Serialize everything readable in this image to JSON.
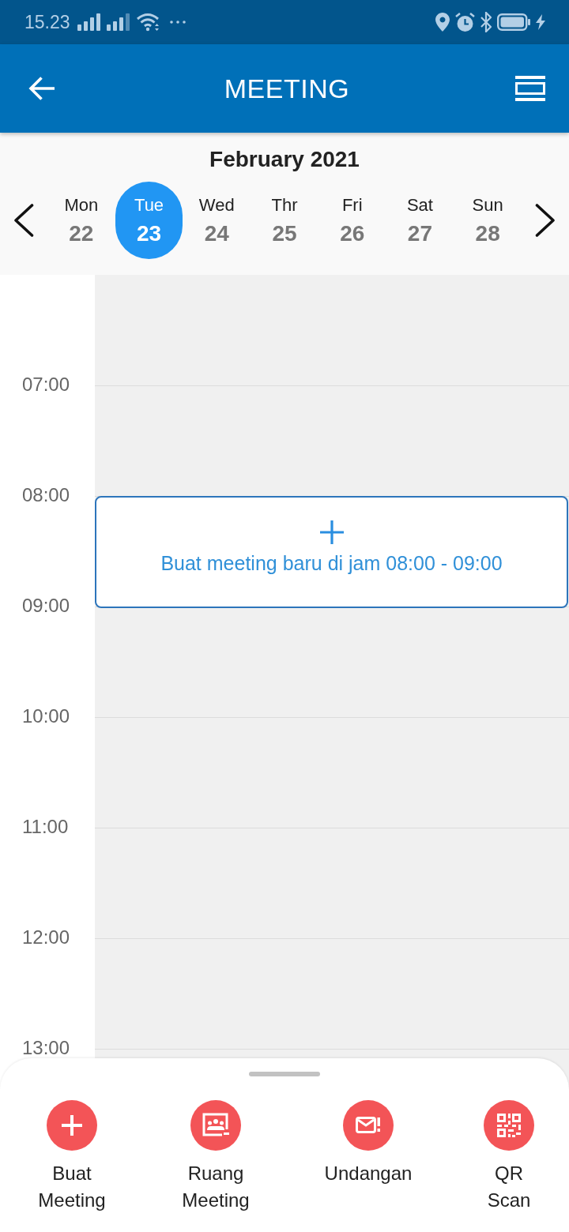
{
  "status_bar": {
    "time": "15.23"
  },
  "app_bar": {
    "title": "MEETING"
  },
  "calendar": {
    "month": "February 2021",
    "days": [
      {
        "name": "Mon",
        "date": "22",
        "selected": false
      },
      {
        "name": "Tue",
        "date": "23",
        "selected": true
      },
      {
        "name": "Wed",
        "date": "24",
        "selected": false
      },
      {
        "name": "Thr",
        "date": "25",
        "selected": false
      },
      {
        "name": "Fri",
        "date": "26",
        "selected": false
      },
      {
        "name": "Sat",
        "date": "27",
        "selected": false
      },
      {
        "name": "Sun",
        "date": "28",
        "selected": false
      }
    ]
  },
  "schedule": {
    "hours": [
      {
        "label": "07:00"
      },
      {
        "label": "08:00",
        "prompt": "Buat meeting baru di jam 08:00 - 09:00"
      },
      {
        "label": "09:00"
      },
      {
        "label": "10:00"
      },
      {
        "label": "11:00"
      },
      {
        "label": "12:00"
      },
      {
        "label": "13:00"
      }
    ]
  },
  "bottom_sheet": {
    "actions": [
      {
        "label": "Buat Meeting",
        "kind": "add"
      },
      {
        "label": "Ruang Meeting",
        "kind": "room"
      },
      {
        "label": "Undangan",
        "kind": "invite"
      },
      {
        "label": "QR Scan",
        "kind": "qr"
      }
    ]
  }
}
